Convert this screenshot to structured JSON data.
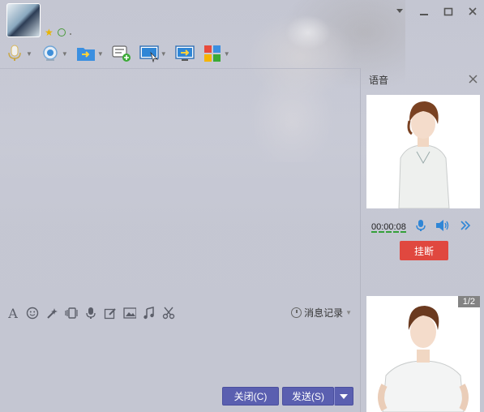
{
  "window": {
    "controls": [
      "skin-caret",
      "minimize",
      "maximize",
      "close"
    ]
  },
  "contact": {
    "avatar_icon": "user-avatar",
    "status_icons": [
      "vip-star-icon",
      "chat-status-icon"
    ]
  },
  "toolbar": {
    "items": [
      {
        "name": "voice-call",
        "icon": "microphone-icon",
        "has_dropdown": true
      },
      {
        "name": "video-call",
        "icon": "camera-icon",
        "has_dropdown": true
      },
      {
        "name": "send-file",
        "icon": "folder-send-icon",
        "has_dropdown": true
      },
      {
        "name": "discussion-group",
        "icon": "chat-add-icon",
        "has_dropdown": false
      },
      {
        "name": "remote-assist",
        "icon": "remote-screen-icon",
        "has_dropdown": true
      },
      {
        "name": "screen-share",
        "icon": "screen-share-icon",
        "has_dropdown": false
      },
      {
        "name": "apps",
        "icon": "apps-grid-icon",
        "has_dropdown": true
      }
    ]
  },
  "input_toolbar": {
    "items": [
      "font-icon",
      "emoji-icon",
      "magic-icon",
      "shake-icon",
      "voice-message-icon",
      "edit-icon",
      "image-icon",
      "music-icon",
      "screenshot-icon"
    ],
    "history_label": "消息记录"
  },
  "buttons": {
    "close_label": "关闭(C)",
    "send_label": "发送(S)"
  },
  "voice_panel": {
    "title": "语音",
    "timer": "00:00:08",
    "hangup_label": "挂断",
    "page_indicator": "1/2"
  },
  "colors": {
    "send_button": "#5a5fb0",
    "hangup_button": "#e0483f",
    "accent_blue": "#2f86d6"
  }
}
